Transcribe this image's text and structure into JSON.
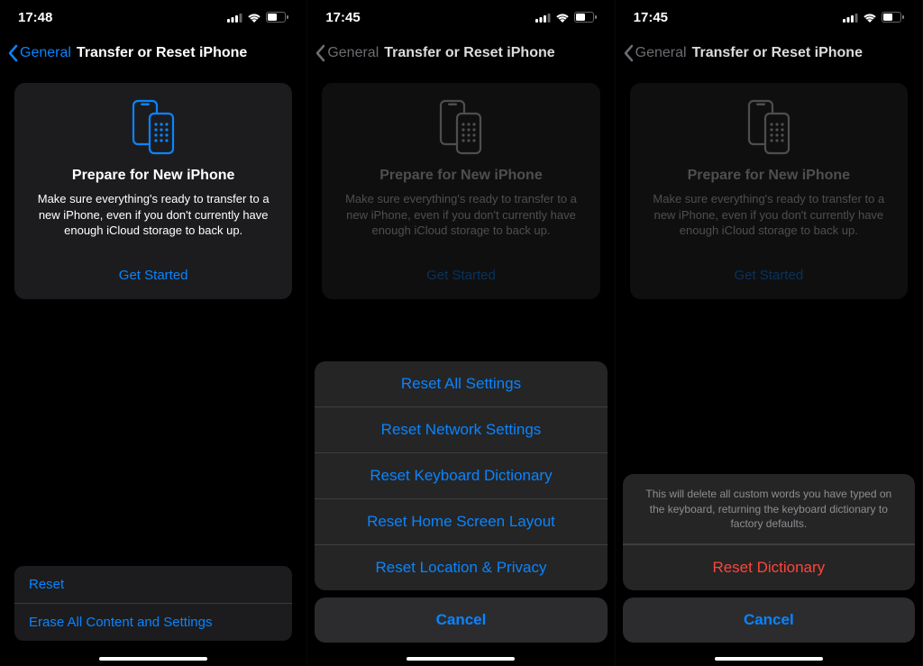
{
  "phones": [
    {
      "time": "17:48",
      "back_label": "General",
      "title": "Transfer or Reset iPhone",
      "card": {
        "title": "Prepare for New iPhone",
        "desc": "Make sure everything's ready to transfer to a new iPhone, even if you don't currently have enough iCloud storage to back up.",
        "link": "Get Started"
      },
      "rows": [
        {
          "label": "Reset"
        },
        {
          "label": "Erase All Content and Settings"
        }
      ]
    },
    {
      "time": "17:45",
      "back_label": "General",
      "title": "Transfer or Reset iPhone",
      "card": {
        "title": "Prepare for New iPhone",
        "desc": "Make sure everything's ready to transfer to a new iPhone, even if you don't currently have enough iCloud storage to back up.",
        "link": "Get Started"
      },
      "sheet": {
        "items": [
          "Reset All Settings",
          "Reset Network Settings",
          "Reset Keyboard Dictionary",
          "Reset Home Screen Layout",
          "Reset Location & Privacy"
        ],
        "cancel": "Cancel"
      }
    },
    {
      "time": "17:45",
      "back_label": "General",
      "title": "Transfer or Reset iPhone",
      "card": {
        "title": "Prepare for New iPhone",
        "desc": "Make sure everything's ready to transfer to a new iPhone, even if you don't currently have enough iCloud storage to back up.",
        "link": "Get Started"
      },
      "confirm": {
        "message": "This will delete all custom words you have typed on the keyboard, returning the keyboard dictionary to factory defaults.",
        "action": "Reset Dictionary",
        "cancel": "Cancel"
      }
    }
  ]
}
